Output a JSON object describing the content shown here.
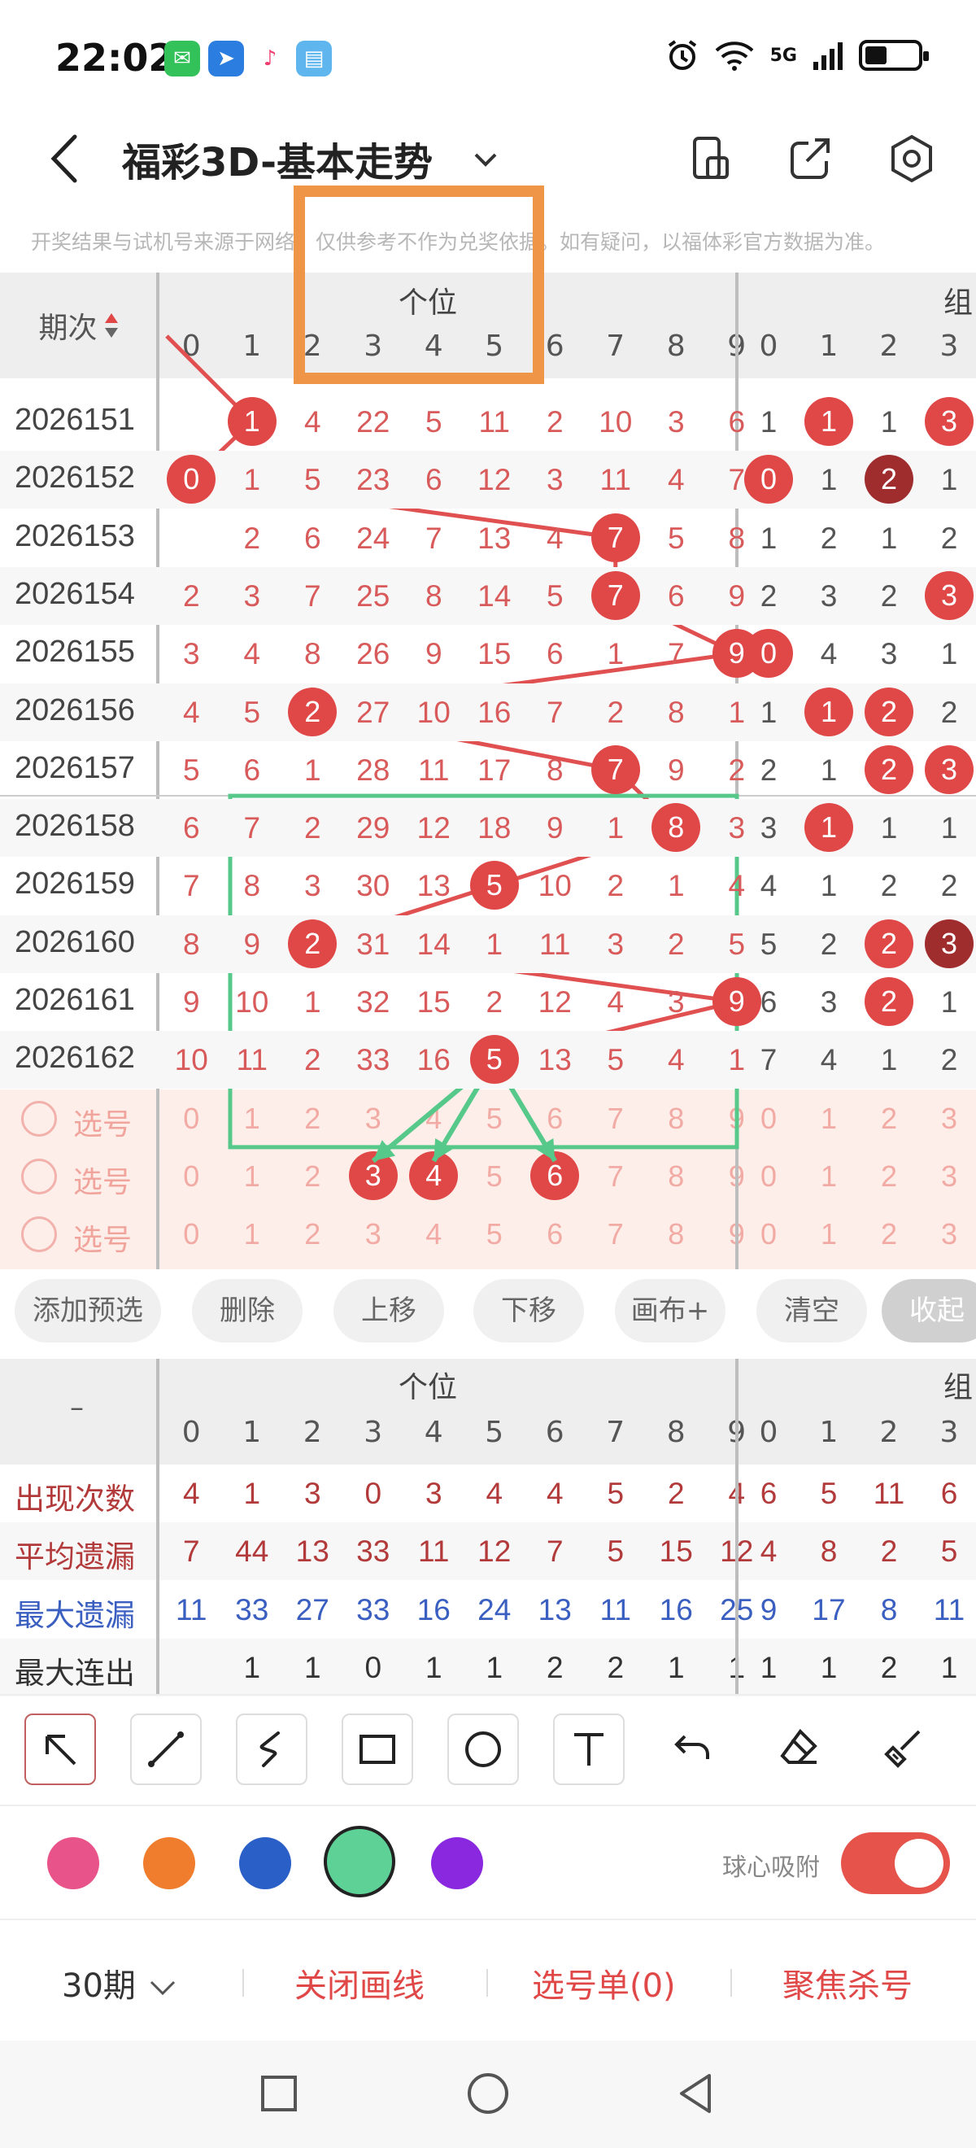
{
  "status_bar": {
    "time": "22:02",
    "network": "5G"
  },
  "header": {
    "title": "福彩3D-基本走势"
  },
  "notice": "开奖结果与试机号来源于网络，仅供参考不作为兑奖依据。如有疑问，以福体彩官方数据为准。",
  "grid": {
    "issue_header": "期次",
    "group_units": "个位",
    "group_zu": "组",
    "columns": [
      "0",
      "1",
      "2",
      "3",
      "4",
      "5",
      "6",
      "7",
      "8",
      "9"
    ],
    "zu_columns": [
      "0",
      "1",
      "2",
      "3"
    ],
    "rows": [
      {
        "issue": "2026151",
        "cells": [
          "",
          "1",
          "4",
          "22",
          "5",
          "11",
          "2",
          "10",
          "3",
          "6"
        ],
        "hit": 1,
        "zu": [
          "1",
          "1",
          "1",
          "3"
        ],
        "zu_hits": [
          1,
          3
        ]
      },
      {
        "issue": "2026152",
        "cells": [
          "0",
          "1",
          "5",
          "23",
          "6",
          "12",
          "3",
          "11",
          "4",
          "7"
        ],
        "hit": 0,
        "zu": [
          "0",
          "1",
          "2",
          "1"
        ],
        "zu_hits": [
          0,
          2
        ]
      },
      {
        "issue": "2026153",
        "cells": [
          "",
          "2",
          "6",
          "24",
          "7",
          "13",
          "4",
          "7",
          "5",
          "8"
        ],
        "hit": 7,
        "zu": [
          "1",
          "2",
          "1",
          "2"
        ],
        "zu_hits": []
      },
      {
        "issue": "2026154",
        "cells": [
          "2",
          "3",
          "7",
          "25",
          "8",
          "14",
          "5",
          "7",
          "6",
          "9"
        ],
        "hit": 7,
        "zu": [
          "2",
          "3",
          "2",
          "3"
        ],
        "zu_hits": [
          3
        ]
      },
      {
        "issue": "2026155",
        "cells": [
          "3",
          "4",
          "8",
          "26",
          "9",
          "15",
          "6",
          "1",
          "7",
          "9"
        ],
        "hit": 9,
        "zu": [
          "0",
          "4",
          "3",
          "1"
        ],
        "zu_hits": [
          0
        ]
      },
      {
        "issue": "2026156",
        "cells": [
          "4",
          "5",
          "2",
          "27",
          "10",
          "16",
          "7",
          "2",
          "8",
          "1"
        ],
        "hit": 2,
        "zu": [
          "1",
          "1",
          "2",
          "2"
        ],
        "zu_hits": [
          1,
          2
        ]
      },
      {
        "issue": "2026157",
        "cells": [
          "5",
          "6",
          "1",
          "28",
          "11",
          "17",
          "8",
          "7",
          "9",
          "2"
        ],
        "hit": 7,
        "zu": [
          "2",
          "1",
          "2",
          "3"
        ],
        "zu_hits": [
          2,
          3
        ]
      },
      {
        "issue": "2026158",
        "cells": [
          "6",
          "7",
          "2",
          "29",
          "12",
          "18",
          "9",
          "1",
          "8",
          "3"
        ],
        "hit": 8,
        "zu": [
          "3",
          "1",
          "1",
          "1"
        ],
        "zu_hits": [
          1
        ]
      },
      {
        "issue": "2026159",
        "cells": [
          "7",
          "8",
          "3",
          "30",
          "13",
          "5",
          "10",
          "2",
          "1",
          "4"
        ],
        "hit": 5,
        "zu": [
          "4",
          "1",
          "2",
          "2"
        ],
        "zu_hits": []
      },
      {
        "issue": "2026160",
        "cells": [
          "8",
          "9",
          "2",
          "31",
          "14",
          "1",
          "11",
          "3",
          "2",
          "5"
        ],
        "hit": 2,
        "zu": [
          "5",
          "2",
          "2",
          "3"
        ],
        "zu_hits": [
          2,
          3
        ]
      },
      {
        "issue": "2026161",
        "cells": [
          "9",
          "10",
          "1",
          "32",
          "15",
          "2",
          "12",
          "4",
          "3",
          "9"
        ],
        "hit": 9,
        "zu": [
          "6",
          "3",
          "2",
          "1"
        ],
        "zu_hits": [
          2
        ]
      },
      {
        "issue": "2026162",
        "cells": [
          "10",
          "11",
          "2",
          "33",
          "16",
          "5",
          "13",
          "5",
          "4",
          "1"
        ],
        "hit": 5,
        "zu": [
          "7",
          "4",
          "1",
          "2"
        ],
        "zu_hits": []
      }
    ],
    "pick_label": "选号",
    "pick_rows": [
      {
        "selected": []
      },
      {
        "selected": [
          3,
          4,
          6
        ]
      },
      {
        "selected": []
      }
    ]
  },
  "actions": [
    "添加预选",
    "删除",
    "上移",
    "下移",
    "画布+",
    "清空",
    "收起"
  ],
  "stats": {
    "dash": "–",
    "group_units": "个位",
    "group_zu": "组",
    "rows": [
      {
        "label": "出现次数",
        "color": "#b23a3a",
        "values": [
          "4",
          "1",
          "3",
          "0",
          "3",
          "4",
          "4",
          "5",
          "2",
          "4"
        ],
        "zu": [
          "6",
          "5",
          "11",
          "6"
        ]
      },
      {
        "label": "平均遗漏",
        "color": "#b23a3a",
        "values": [
          "7",
          "44",
          "13",
          "33",
          "11",
          "12",
          "7",
          "5",
          "15",
          "12"
        ],
        "zu": [
          "4",
          "8",
          "2",
          "5"
        ]
      },
      {
        "label": "最大遗漏",
        "color": "#3a5fc0",
        "values": [
          "11",
          "33",
          "27",
          "33",
          "16",
          "24",
          "13",
          "11",
          "16",
          "25"
        ],
        "zu": [
          "9",
          "17",
          "8",
          "11"
        ]
      },
      {
        "label": "最大连出",
        "color": "#333333",
        "values": [
          "",
          "1",
          "1",
          "0",
          "1",
          "1",
          "2",
          "2",
          "1",
          "1"
        ],
        "zu": [
          "1",
          "1",
          "2",
          "1"
        ]
      }
    ]
  },
  "tools": [
    "arrow-tool",
    "line-tool",
    "freehand-tool",
    "rectangle-tool",
    "circle-tool",
    "text-tool",
    "undo-tool",
    "eraser-tool",
    "brush-tool"
  ],
  "palette": {
    "colors": [
      "#e8538a",
      "#f07d2e",
      "#2a5fc8",
      "#5ed197",
      "#8a28e0"
    ],
    "selected": "#5ed197",
    "snap_label": "球心吸附",
    "snap_on": true
  },
  "bottom": {
    "period": "30期",
    "close_draw": "关闭画线",
    "pick_list": "选号单(0)",
    "focus_kill": "聚焦杀号"
  },
  "annotations": {
    "orange_box": "#ef9548",
    "green_box": "#56c98a",
    "trend_line": "#e05050"
  }
}
